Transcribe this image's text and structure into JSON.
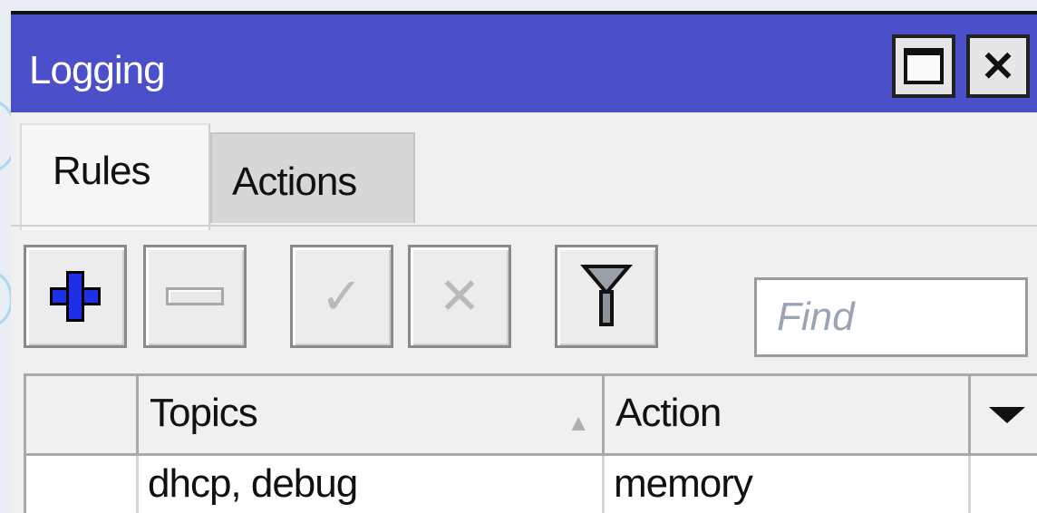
{
  "window": {
    "title": "Logging",
    "maximize_icon": "maximize-icon",
    "close_icon": "close-icon"
  },
  "tabs": [
    {
      "label": "Rules",
      "active": true
    },
    {
      "label": "Actions",
      "active": false
    }
  ],
  "toolbar": {
    "buttons": [
      {
        "name": "add",
        "icon": "plus-icon",
        "enabled": true
      },
      {
        "name": "remove",
        "icon": "minus-icon",
        "enabled": false
      },
      {
        "name": "enable",
        "icon": "check-icon",
        "enabled": false
      },
      {
        "name": "disable",
        "icon": "cross-icon",
        "enabled": false
      },
      {
        "name": "filter",
        "icon": "funnel-icon",
        "enabled": true
      }
    ],
    "find_placeholder": "Find"
  },
  "table": {
    "columns": [
      {
        "label": ""
      },
      {
        "label": "Topics",
        "sort": "ascending"
      },
      {
        "label": "Action"
      },
      {
        "label": ""
      }
    ],
    "rows": [
      {
        "topics": "dhcp, debug",
        "action": "memory"
      }
    ]
  },
  "colors": {
    "titlebar": "#4b4fc9",
    "add_icon": "#1f2fe8"
  }
}
